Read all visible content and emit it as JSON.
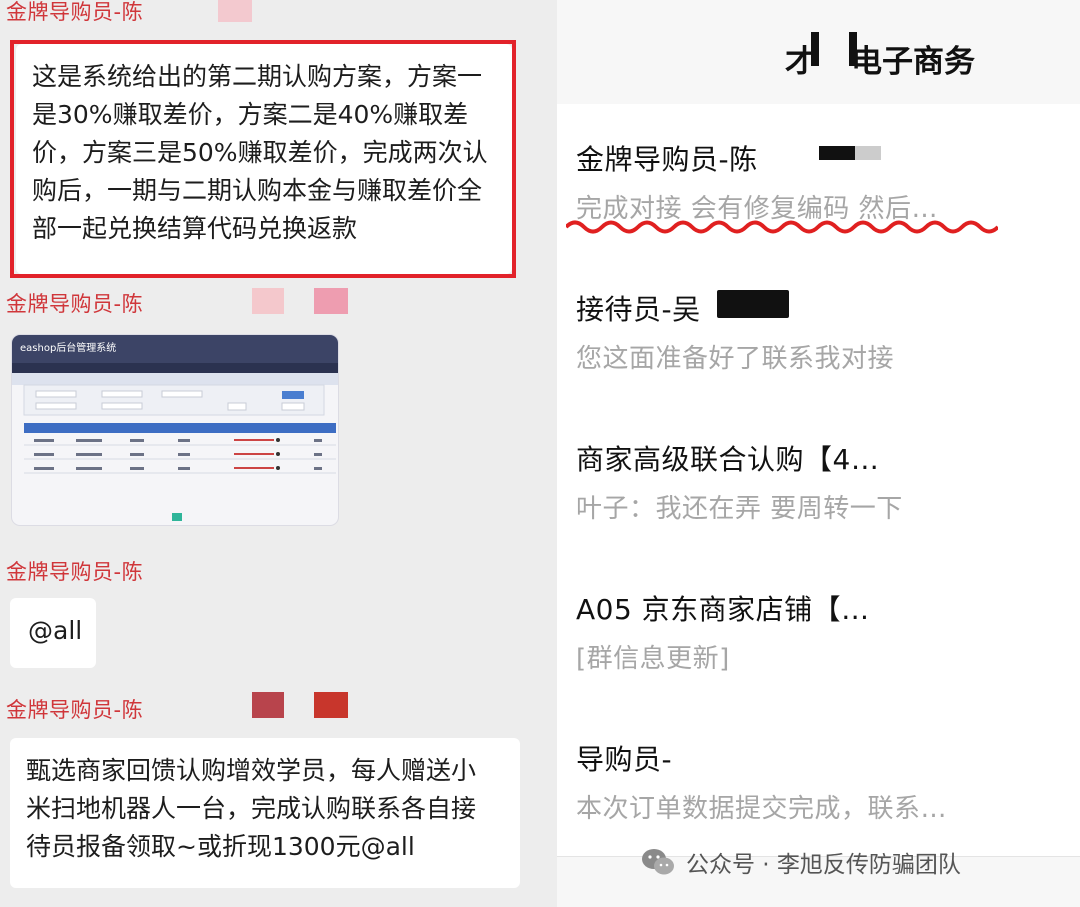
{
  "left_chat": {
    "messages": [
      {
        "sender": "金牌导购员-陈",
        "text": "这是系统给出的第二期认购方案，方案一\n是30%赚取差价，方案二是40%赚取差\n价，方案三是50%赚取差价，完成两次认\n购后，一期与二期认购本金与赚取差价全\n部一起兑换结算代码兑换返款"
      },
      {
        "sender": "金牌导购员-陈",
        "image_header": "eashop后台管理系统"
      },
      {
        "sender": "金牌导购员-陈",
        "text": "@all"
      },
      {
        "sender": "金牌导购员-陈",
        "text": "甄选商家回馈认购增效学员，每人赠送小\n米扫地机器人一台，完成认购联系各自接\n待员报备领取~或折现1300元@all"
      }
    ]
  },
  "right_panel": {
    "title": "电子商务",
    "title_prefix": "才",
    "chats": [
      {
        "name": "金牌导购员-陈",
        "preview": "完成对接  会有修复编码   然后…"
      },
      {
        "name": "接待员-吴",
        "preview": "您这面准备好了联系我对接"
      },
      {
        "name": "商家高级联合认购【4…",
        "preview": "叶子：我还在弄  要周转一下"
      },
      {
        "name": "A05 京东商家店铺【…",
        "preview": "[群信息更新]"
      },
      {
        "name": "导购员-",
        "preview": "本次订单数据提交完成，联系…"
      }
    ]
  },
  "watermark": {
    "text": "公众号 · 李旭反传防骗团队"
  },
  "colors": {
    "sender_red": "#d0363a",
    "frame_red": "#e2222a",
    "wave_red": "#e02020"
  }
}
